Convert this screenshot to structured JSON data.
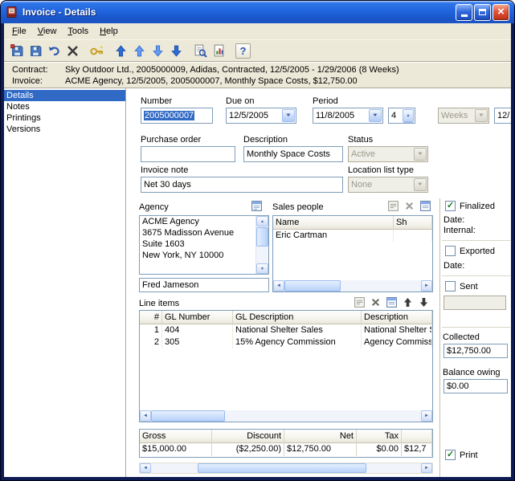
{
  "window": {
    "title": "Invoice - Details"
  },
  "colors": {
    "titlebar": "#1F63DC",
    "selection": "#316AC5",
    "chrome": "#ECE9D8"
  },
  "menu": {
    "items": [
      "File",
      "View",
      "Tools",
      "Help"
    ]
  },
  "toolbar": {
    "icons": [
      "save-close-icon",
      "save-icon",
      "undo-icon",
      "delete-icon",
      "generate-number-icon",
      "nav-up-icon",
      "nav-up-alt-icon",
      "nav-down-icon",
      "nav-down-alt-icon",
      "print-preview-icon",
      "report-icon",
      "help-icon"
    ]
  },
  "infobar": {
    "contract_label": "Contract:",
    "contract_value": "Sky Outdoor Ltd., 2005000009, Adidas, Contracted, 12/5/2005 - 1/29/2006 (8 Weeks)",
    "invoice_label": "Invoice:",
    "invoice_value": "ACME Agency, 12/5/2005, 2005000007, Monthly Space Costs, $12,750.00"
  },
  "sidebar": {
    "items": [
      {
        "label": "Details",
        "selected": true
      },
      {
        "label": "Notes",
        "selected": false
      },
      {
        "label": "Printings",
        "selected": false
      },
      {
        "label": "Versions",
        "selected": false
      }
    ]
  },
  "form": {
    "number": {
      "label": "Number",
      "value": "2005000007"
    },
    "due_on": {
      "label": "Due on",
      "value": "12/5/2005"
    },
    "period": {
      "label": "Period",
      "start": "11/8/2005",
      "count": "4",
      "unit": "Weeks",
      "end_partial": "12/"
    },
    "purchase_order": {
      "label": "Purchase order",
      "value": ""
    },
    "description": {
      "label": "Description",
      "value": "Monthly Space Costs"
    },
    "status": {
      "label": "Status",
      "value": "Active"
    },
    "invoice_note": {
      "label": "Invoice note",
      "value": "Net 30 days"
    },
    "location_list_type": {
      "label": "Location list type",
      "value": "None"
    }
  },
  "agency": {
    "label": "Agency",
    "address_lines": [
      "ACME Agency",
      "3675 Madisson Avenue",
      "Suite 1603",
      "New York, NY 10000"
    ],
    "contact": "Fred Jameson"
  },
  "sales_people": {
    "label": "Sales people",
    "columns": [
      "Name",
      "Sh"
    ],
    "rows": [
      [
        "Eric Cartman",
        ""
      ]
    ]
  },
  "flags": {
    "finalized": {
      "label": "Finalized",
      "checked": true,
      "date_label": "Date:",
      "internal_label": "Internal:"
    },
    "exported": {
      "label": "Exported",
      "checked": false,
      "date_label": "Date:"
    },
    "sent": {
      "label": "Sent",
      "checked": false,
      "value": ""
    }
  },
  "line_items": {
    "label": "Line items",
    "columns": [
      "#",
      "GL Number",
      "GL Description",
      "Description"
    ],
    "rows": [
      [
        "1",
        "404",
        "National Shelter Sales",
        "National Shelter S"
      ],
      [
        "2",
        "305",
        "15% Agency Commission",
        "Agency Commissi"
      ]
    ],
    "totals_columns": [
      "Gross",
      "Discount",
      "Net",
      "Tax",
      ""
    ],
    "totals_row": [
      "$15,000.00",
      "($2,250.00)",
      "$12,750.00",
      "$0.00",
      "$12,7"
    ]
  },
  "summary": {
    "collected_label": "Collected",
    "collected_value": "$12,750.00",
    "balance_label": "Balance owing",
    "balance_value": "$0.00",
    "print_label": "Print"
  }
}
